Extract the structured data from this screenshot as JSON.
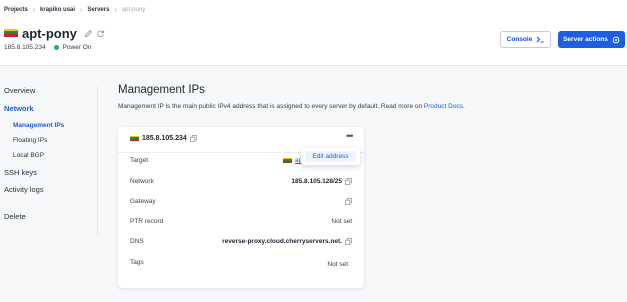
{
  "breadcrumb": {
    "items": [
      "Projects",
      "krapiko usai",
      "Servers",
      "apt-pony"
    ]
  },
  "server": {
    "name": "apt-pony",
    "ip": "185.8.105.234",
    "status": "Power On",
    "status_color": "#23b15a",
    "flag": "lithuania-flag"
  },
  "header_actions": {
    "console_label": "Console",
    "actions_label": "Server actions"
  },
  "sidebar": {
    "items": [
      {
        "label": "Overview"
      },
      {
        "label": "Network",
        "active": true
      },
      {
        "label": "Management IPs",
        "active": true
      },
      {
        "label": "Floating IPs"
      },
      {
        "label": "Local BGP"
      },
      {
        "label": "SSH keys"
      },
      {
        "label": "Activity logs"
      },
      {
        "label": "Delete"
      }
    ]
  },
  "main": {
    "title": "Management IPs",
    "description": "Management IP is the main public IPv4 address that is assigned to every server by default. Read more on",
    "description_link": "Product Docs",
    "description_end": "."
  },
  "card": {
    "ip": "185.8.105.234",
    "rows": [
      {
        "label": "Target",
        "value": "apt-pony"
      },
      {
        "label": "Network",
        "value": "185.8.105.128/25"
      },
      {
        "label": "Gateway",
        "value": ""
      },
      {
        "label": "PTR record",
        "value": "Not set"
      },
      {
        "label": "DNS",
        "value": "reverse-proxy.cloud.cherryservers.net."
      },
      {
        "label": "Tags",
        "value": "Not set"
      }
    ],
    "target_short": "apt"
  },
  "dropdown": {
    "items": [
      "Edit address"
    ]
  },
  "colors": {
    "accent": "#1d5fe0",
    "success": "#23b15a"
  }
}
